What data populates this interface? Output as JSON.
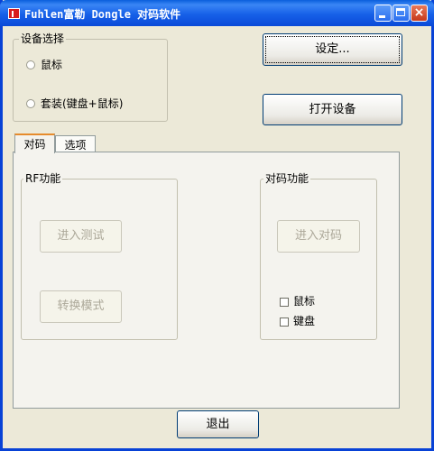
{
  "window": {
    "title": "Fuhlen富勒 Dongle 对码软件"
  },
  "device_select": {
    "legend": "设备选择",
    "options": [
      {
        "label": "鼠标",
        "selected": false
      },
      {
        "label": "套装(键盘+鼠标)",
        "selected": false
      }
    ]
  },
  "buttons": {
    "settings": "设定...",
    "open_device": "打开设备",
    "exit": "退出"
  },
  "tabs": [
    {
      "label": "对码",
      "active": true
    },
    {
      "label": "选项",
      "active": false
    }
  ],
  "rf_group": {
    "legend": "RF功能",
    "enter_test": "进入测试",
    "switch_mode": "转换模式"
  },
  "pair_group": {
    "legend": "对码功能",
    "enter_pair": "进入对码",
    "checkboxes": [
      {
        "label": "鼠标",
        "checked": false
      },
      {
        "label": "键盘",
        "checked": false
      }
    ]
  }
}
